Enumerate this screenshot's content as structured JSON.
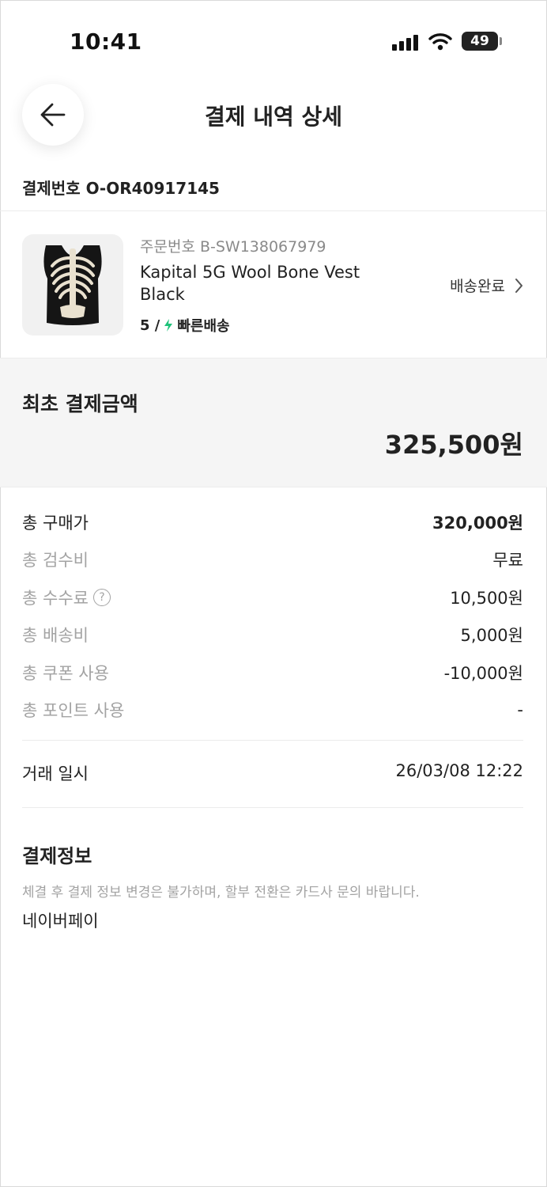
{
  "status_bar": {
    "time": "10:41",
    "battery": "49"
  },
  "header": {
    "title": "결제 내역 상세",
    "back_icon": "arrow-left-icon"
  },
  "payment_number": "결제번호 O-OR40917145",
  "product": {
    "order_number": "주문번호 B-SW138067979",
    "name": "Kapital 5G Wool Bone Vest Black",
    "size": "5 /",
    "shipping_type": "빠른배송",
    "shipping_icon_color": "#1ec27a",
    "status": "배송완료"
  },
  "first_payment": {
    "label": "최초 결제금액",
    "amount": "325,500원"
  },
  "price_rows": [
    {
      "label": "총 구매가",
      "value": "320,000원"
    },
    {
      "label": "총 검수비",
      "value": "무료"
    },
    {
      "label": "총 수수료",
      "value": "10,500원",
      "help": "?"
    },
    {
      "label": "총 배송비",
      "value": "5,000원"
    },
    {
      "label": "총 쿠폰 사용",
      "value": "-10,000원"
    },
    {
      "label": "총 포인트 사용",
      "value": "-"
    }
  ],
  "trade": {
    "label": "거래 일시",
    "value": "26/03/08 12:22"
  },
  "payment_info": {
    "title": "결제정보",
    "note": "체결 후 결제 정보 변경은 불가하며, 할부 전환은 카드사 문의 바랍니다.",
    "method": "네이버페이"
  }
}
